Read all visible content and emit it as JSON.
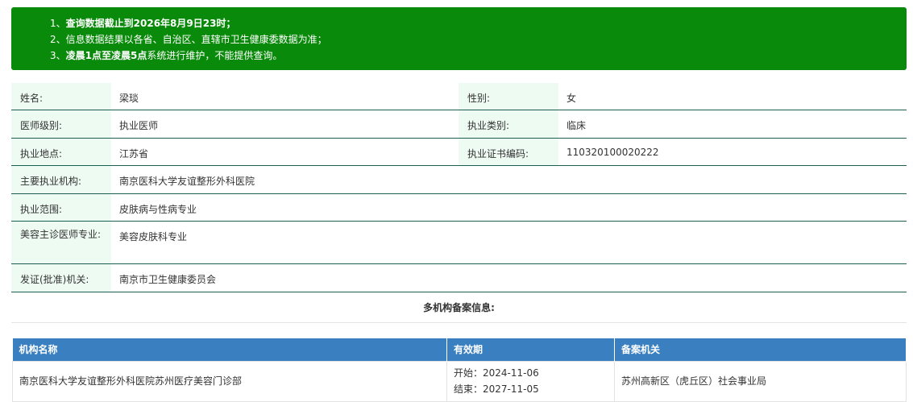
{
  "notice": {
    "lines": [
      {
        "num": "1、",
        "bold": "查询数据截止到2026年8月9日23时；",
        "rest": ""
      },
      {
        "num": "2、",
        "bold": "",
        "rest": "信息数据结果以各省、自治区、直辖市卫生健康委数据为准；"
      },
      {
        "num": "3、",
        "bold": "凌晨1点至凌晨5点",
        "rest": "系统进行维护，不能提供查询。"
      }
    ]
  },
  "info": {
    "name_label": "姓名:",
    "name_value": "梁琰",
    "gender_label": "性别:",
    "gender_value": "女",
    "level_label": "医师级别:",
    "level_value": "执业医师",
    "type_label": "执业类别:",
    "type_value": "临床",
    "location_label": "执业地点:",
    "location_value": "江苏省",
    "cert_label": "执业证书编码:",
    "cert_value": "110320100020222",
    "org_label": "主要执业机构:",
    "org_value": "南京医科大学友谊整形外科医院",
    "scope_label": "执业范围:",
    "scope_value": "皮肤病与性病专业",
    "cosmetic_label": "美容主诊医师专业:",
    "cosmetic_value": "美容皮肤科专业",
    "issuer_label": "发证(批准)机关:",
    "issuer_value": "南京市卫生健康委员会"
  },
  "multi_title": "多机构备案信息:",
  "filing": {
    "headers": [
      "机构名称",
      "有效期",
      "备案机关"
    ],
    "rows": [
      {
        "org": "南京医科大学友谊整形外科医院苏州医疗美容门诊部",
        "start": "开始：2024-11-06",
        "end": "结束：2027-11-05",
        "authority": "苏州高新区（虎丘区）社会事业局"
      }
    ]
  }
}
